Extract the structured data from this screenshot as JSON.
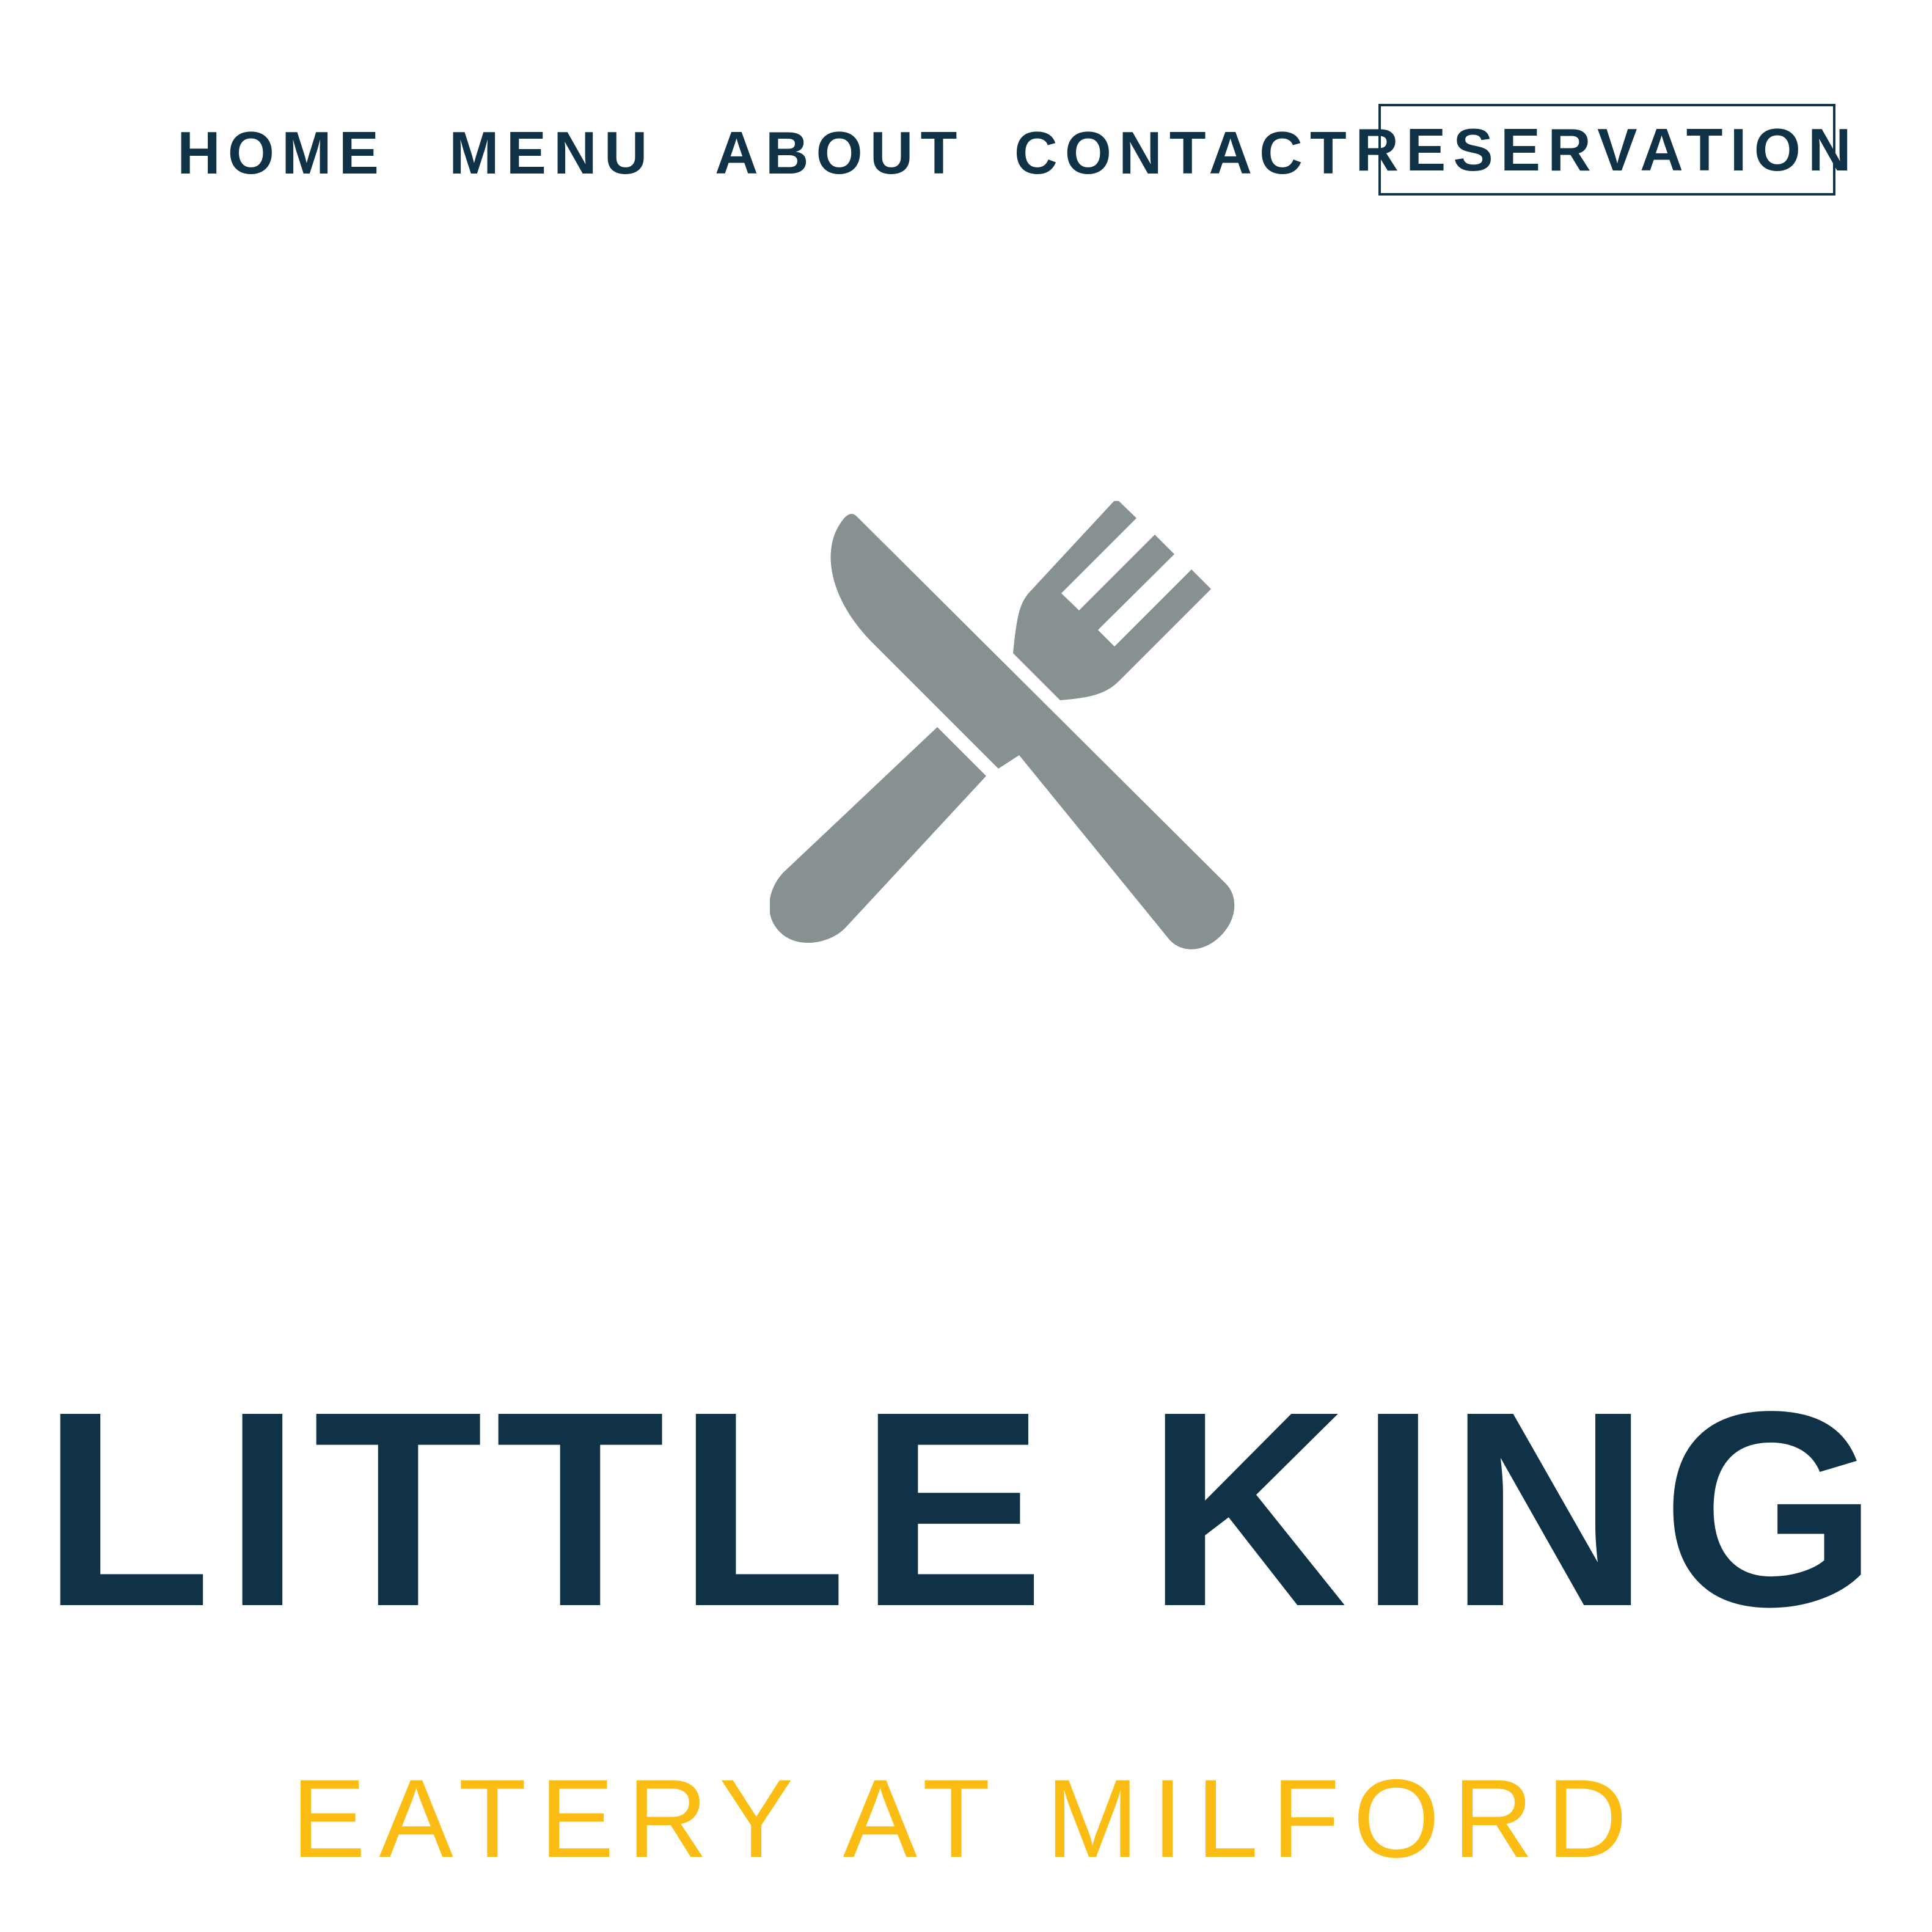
{
  "nav": {
    "links": [
      {
        "label": "HOME"
      },
      {
        "label": "MENU"
      },
      {
        "label": "ABOUT"
      },
      {
        "label": "CONTACT"
      }
    ],
    "reservation_label": "RESERVATION"
  },
  "hero": {
    "logo_icon": "knife-and-fork-icon",
    "title": "LITTLE KING",
    "subtitle": "EATERY AT MILFORD"
  },
  "colors": {
    "navy": "#0f3246",
    "gold": "#fbbd14",
    "icon_gray": "#879191",
    "background": "#ffffff"
  }
}
